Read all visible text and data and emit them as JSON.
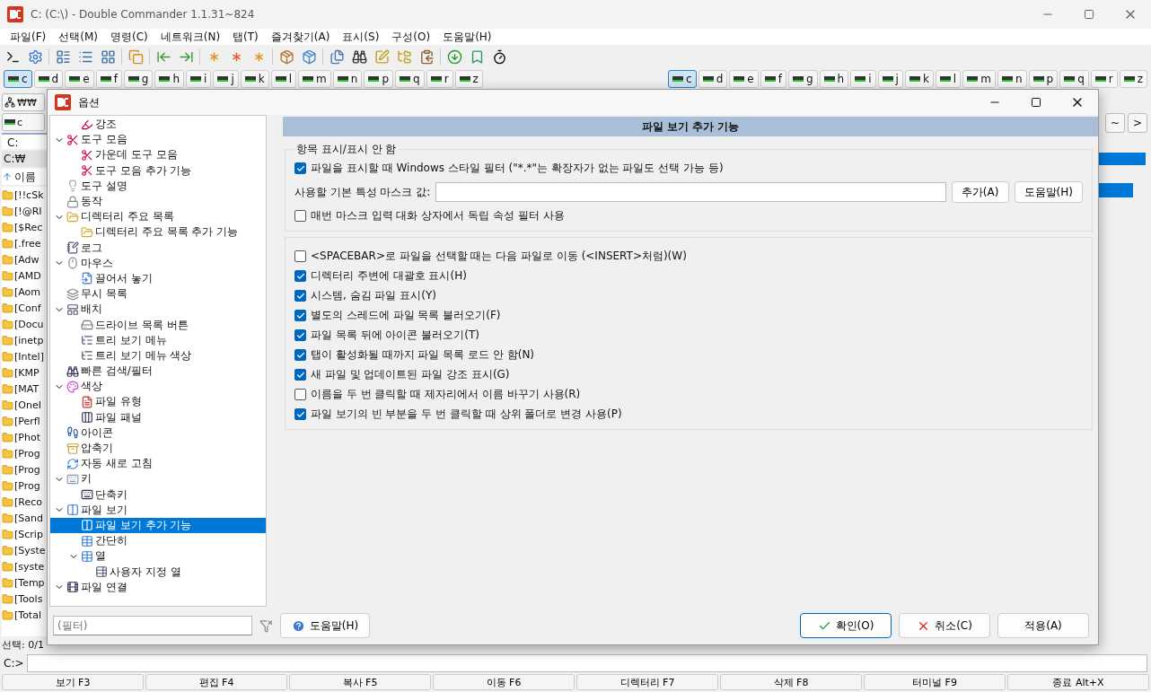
{
  "window": {
    "title": "C: (C:\\) - Double Commander 1.1.31~824"
  },
  "menu": [
    "파일(F)",
    "선택(M)",
    "명령(C)",
    "네트워크(N)",
    "탭(T)",
    "즐겨찾기(A)",
    "표시(S)",
    "구성(O)",
    "도움말(H)"
  ],
  "drive_bars": [
    {
      "drives": [
        {
          "label": "c",
          "selected": true
        },
        {
          "label": "d",
          "selected": false
        },
        {
          "label": "e",
          "selected": false
        },
        {
          "label": "f",
          "selected": false
        },
        {
          "label": "g",
          "selected": false
        },
        {
          "label": "h",
          "selected": false
        },
        {
          "label": "i",
          "selected": false
        },
        {
          "label": "j",
          "selected": false
        },
        {
          "label": "k",
          "selected": false
        },
        {
          "label": "l",
          "selected": false
        },
        {
          "label": "m",
          "selected": false
        },
        {
          "label": "n",
          "selected": false
        },
        {
          "label": "p",
          "selected": false
        },
        {
          "label": "q",
          "selected": false
        },
        {
          "label": "r",
          "selected": false
        },
        {
          "label": "z",
          "selected": false
        }
      ]
    },
    {
      "drives": [
        {
          "label": "c",
          "selected": true
        },
        {
          "label": "d",
          "selected": false
        },
        {
          "label": "e",
          "selected": false
        },
        {
          "label": "f",
          "selected": false
        },
        {
          "label": "g",
          "selected": false
        },
        {
          "label": "h",
          "selected": false
        },
        {
          "label": "i",
          "selected": false
        },
        {
          "label": "j",
          "selected": false
        },
        {
          "label": "k",
          "selected": false
        },
        {
          "label": "l",
          "selected": false
        },
        {
          "label": "m",
          "selected": false
        },
        {
          "label": "n",
          "selected": false
        },
        {
          "label": "p",
          "selected": false
        },
        {
          "label": "q",
          "selected": false
        },
        {
          "label": "r",
          "selected": false
        },
        {
          "label": "z",
          "selected": false
        }
      ]
    }
  ],
  "left_panel": {
    "network_button": "₩₩",
    "drive_button": "c",
    "path": "C:",
    "header": "C:₩",
    "column": "이름",
    "files": [
      "[!!cSk",
      "[!@RI",
      "[$Rec",
      "[.free",
      "[Adw",
      "[AMD",
      "[Aom",
      "[Conf",
      "[Docu",
      "[inetp",
      "[Intel]",
      "[KMP",
      "[MAT",
      "[OneI",
      "[Perfl",
      "[Phot",
      "[Prog",
      "[Prog",
      "[Prog",
      "[Reco",
      "[Sand",
      "[Scrip",
      "[Syste",
      "[syste",
      "[Temp",
      "[Tools",
      "[Total"
    ],
    "status": "선택: 0/1"
  },
  "right_panel": {
    "buttons": [
      "~",
      ">"
    ]
  },
  "command_line": {
    "prompt": "C:>"
  },
  "function_keys": [
    "보기 F3",
    "편집 F4",
    "복사 F5",
    "이동 F6",
    "디렉터리 F7",
    "삭제 F8",
    "터미널 F9",
    "종료 Alt+X"
  ],
  "dialog": {
    "title": "옵션",
    "tree": [
      {
        "children": [
          {
            "label": "강조",
            "selected": false
          }
        ]
      },
      {
        "label": "도구 모음",
        "expanded": true,
        "selected": false,
        "children": [
          {
            "label": "가운데 도구 모음",
            "selected": false
          },
          {
            "label": "도구 모음 추가 기능",
            "selected": false
          }
        ]
      },
      {
        "label": "도구 설명",
        "selected": false
      },
      {
        "label": "동작",
        "selected": false
      },
      {
        "label": "디렉터리 주요 목록",
        "expanded": true,
        "selected": false,
        "children": [
          {
            "label": "디렉터리 주요 목록 추가 기능",
            "selected": false
          }
        ]
      },
      {
        "label": "로그",
        "selected": false
      },
      {
        "label": "마우스",
        "expanded": true,
        "selected": false,
        "children": [
          {
            "label": "끌어서 놓기",
            "selected": false
          }
        ]
      },
      {
        "label": "무시 목록",
        "selected": false
      },
      {
        "label": "배치",
        "expanded": true,
        "selected": false,
        "children": [
          {
            "label": "드라이브 목록 버튼",
            "selected": false
          },
          {
            "label": "트리 보기 메뉴",
            "selected": false
          },
          {
            "label": "트리 보기 메뉴 색상",
            "selected": false
          }
        ]
      },
      {
        "label": "빠른 검색/필터",
        "selected": false
      },
      {
        "label": "색상",
        "expanded": true,
        "selected": false,
        "children": [
          {
            "label": "파일 유형",
            "selected": false
          },
          {
            "label": "파일 패널",
            "selected": false
          }
        ]
      },
      {
        "label": "아이콘",
        "selected": false
      },
      {
        "label": "압축기",
        "selected": false
      },
      {
        "label": "자동 새로 고침",
        "selected": false
      },
      {
        "label": "키",
        "expanded": true,
        "selected": false,
        "children": [
          {
            "label": "단축키",
            "selected": false
          }
        ]
      },
      {
        "label": "파일 보기",
        "expanded": true,
        "selected": false,
        "children": [
          {
            "label": "파일 보기 추가 기능",
            "selected": true
          },
          {
            "label": "간단히",
            "selected": false
          },
          {
            "label": "열",
            "expanded": true,
            "selected": false,
            "children": [
              {
                "label": "사용자 지정 열",
                "selected": false
              }
            ]
          }
        ]
      },
      {
        "label": "파일 연결",
        "expanded": true,
        "selected": false
      }
    ],
    "filter": {
      "placeholder": "(필터)"
    },
    "page_title": "파일 보기 추가 기능",
    "group": {
      "title": "항목 표시/표시 안 함",
      "windows_filter": {
        "label": "파일을 표시할 때 Windows 스타일 필터 (\"*.*\"는 확장자가 없는 파일도 선택 가능 등)",
        "checked": true
      },
      "mask_label": "사용할 기본 특성 마스크 값:",
      "mask_buttons": [
        "추가(A)",
        "도움말(H)"
      ],
      "independent_filter": {
        "label": "매번 마스크 입력 대화 상자에서 독립 속성 필터 사용",
        "checked": false
      }
    },
    "options": [
      {
        "label": "<SPACEBAR>로 파일을 선택할 때는 다음 파일로 이동 (<INSERT>처럼)(W)",
        "checked": false
      },
      {
        "label": "디렉터리 주변에 대괄호 표시(H)",
        "checked": true
      },
      {
        "label": "시스템, 숨김 파일 표시(Y)",
        "checked": true
      },
      {
        "label": "별도의 스레드에 파일 목록 불러오기(F)",
        "checked": true
      },
      {
        "label": "파일 목록 뒤에 아이콘 불러오기(T)",
        "checked": true
      },
      {
        "label": "탭이 활성화될 때까지 파일 목록 로드 안 함(N)",
        "checked": true
      },
      {
        "label": "새 파일 및 업데이트된 파일 강조 표시(G)",
        "checked": true
      },
      {
        "label": "이름을 두 번 클릭할 때 제자리에서 이름 바꾸기 사용(R)",
        "checked": false
      },
      {
        "label": "파일 보기의 빈 부분을 두 번 클릭할 때 상위 폴더로 변경 사용(P)",
        "checked": true
      }
    ],
    "help_button": "도움말(H)",
    "buttons": [
      {
        "kind": "ok",
        "label": "확인(O)"
      },
      {
        "kind": "cancel",
        "label": "취소(C)"
      },
      {
        "kind": "apply",
        "label": "적용(A)"
      }
    ]
  }
}
